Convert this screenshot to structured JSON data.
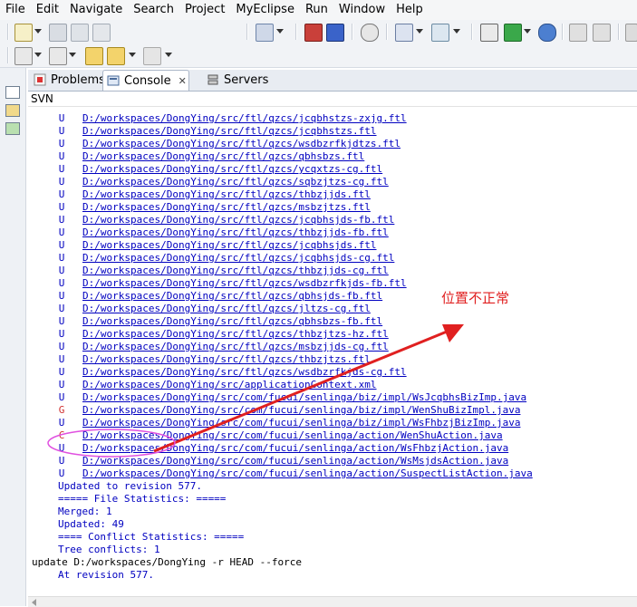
{
  "menu": [
    "File",
    "Edit",
    "Navigate",
    "Search",
    "Project",
    "MyEclipse",
    "Run",
    "Window",
    "Help"
  ],
  "tabs": [
    {
      "label": "Problems"
    },
    {
      "label": "Console"
    },
    {
      "label": "Servers"
    }
  ],
  "view_title": "SVN",
  "console_lines": [
    {
      "flag": "U",
      "text": "D:/workspaces/DongYing/src/ftl/qzcs/jcqbhstzs-zxjg.ftl",
      "flag_color": "#0000c0"
    },
    {
      "flag": "U",
      "text": "D:/workspaces/DongYing/src/ftl/qzcs/jcqbhstzs.ftl",
      "flag_color": "#0000c0"
    },
    {
      "flag": "U",
      "text": "D:/workspaces/DongYing/src/ftl/qzcs/wsdbzrfkjdtzs.ftl",
      "flag_color": "#0000c0"
    },
    {
      "flag": "U",
      "text": "D:/workspaces/DongYing/src/ftl/qzcs/qbhsbzs.ftl",
      "flag_color": "#0000c0"
    },
    {
      "flag": "U",
      "text": "D:/workspaces/DongYing/src/ftl/qzcs/ycqxtzs-cg.ftl",
      "flag_color": "#0000c0"
    },
    {
      "flag": "U",
      "text": "D:/workspaces/DongYing/src/ftl/qzcs/sqbzjtzs-cg.ftl",
      "flag_color": "#0000c0"
    },
    {
      "flag": "U",
      "text": "D:/workspaces/DongYing/src/ftl/qzcs/thbzjjds.ftl",
      "flag_color": "#0000c0"
    },
    {
      "flag": "U",
      "text": "D:/workspaces/DongYing/src/ftl/qzcs/msbzjtzs.ftl",
      "flag_color": "#0000c0"
    },
    {
      "flag": "U",
      "text": "D:/workspaces/DongYing/src/ftl/qzcs/jcqbhsjds-fb.ftl",
      "flag_color": "#0000c0"
    },
    {
      "flag": "U",
      "text": "D:/workspaces/DongYing/src/ftl/qzcs/thbzjjds-fb.ftl",
      "flag_color": "#0000c0"
    },
    {
      "flag": "U",
      "text": "D:/workspaces/DongYing/src/ftl/qzcs/jcqbhsjds.ftl",
      "flag_color": "#0000c0"
    },
    {
      "flag": "U",
      "text": "D:/workspaces/DongYing/src/ftl/qzcs/jcqbhsjds-cg.ftl",
      "flag_color": "#0000c0"
    },
    {
      "flag": "U",
      "text": "D:/workspaces/DongYing/src/ftl/qzcs/thbzjjds-cg.ftl",
      "flag_color": "#0000c0"
    },
    {
      "flag": "U",
      "text": "D:/workspaces/DongYing/src/ftl/qzcs/wsdbzrfkjds-fb.ftl",
      "flag_color": "#0000c0"
    },
    {
      "flag": "U",
      "text": "D:/workspaces/DongYing/src/ftl/qzcs/qbhsjds-fb.ftl",
      "flag_color": "#0000c0"
    },
    {
      "flag": "U",
      "text": "D:/workspaces/DongYing/src/ftl/qzcs/jltzs-cg.ftl",
      "flag_color": "#0000c0"
    },
    {
      "flag": "U",
      "text": "D:/workspaces/DongYing/src/ftl/qzcs/qbhsbzs-fb.ftl",
      "flag_color": "#0000c0"
    },
    {
      "flag": "U",
      "text": "D:/workspaces/DongYing/src/ftl/qzcs/thbzjtzs-hz.ftl",
      "flag_color": "#0000c0"
    },
    {
      "flag": "U",
      "text": "D:/workspaces/DongYing/src/ftl/qzcs/msbzjjds-cg.ftl",
      "flag_color": "#0000c0"
    },
    {
      "flag": "U",
      "text": "D:/workspaces/DongYing/src/ftl/qzcs/thbzjtzs.ftl",
      "flag_color": "#0000c0"
    },
    {
      "flag": "U",
      "text": "D:/workspaces/DongYing/src/ftl/qzcs/wsdbzrfkjds-cg.ftl",
      "flag_color": "#0000c0"
    },
    {
      "flag": "U",
      "text": "D:/workspaces/DongYing/src/applicationContext.xml",
      "flag_color": "#0000c0"
    },
    {
      "flag": "U",
      "text": "D:/workspaces/DongYing/src/com/fucui/senlinga/biz/impl/WsJcqbhsBizImp.java",
      "flag_color": "#0000c0"
    },
    {
      "flag": "G",
      "text": "D:/workspaces/DongYing/src/com/fucui/senlinga/biz/impl/WenShuBizImpl.java",
      "flag_color": "#d03030"
    },
    {
      "flag": "U",
      "text": "D:/workspaces/DongYing/src/com/fucui/senlinga/biz/impl/WsFhbzjBizImp.java",
      "flag_color": "#0000c0"
    },
    {
      "flag": "C",
      "text": "D:/workspaces/DongYing/src/com/fucui/senlinga/action/WenShuAction.java",
      "flag_color": "#d03030"
    },
    {
      "flag": "U",
      "text": "D:/workspaces/DongYing/src/com/fucui/senlinga/action/WsFhbzjAction.java",
      "flag_color": "#0000c0"
    },
    {
      "flag": "U",
      "text": "D:/workspaces/DongYing/src/com/fucui/senlinga/action/WsMsjdsAction.java",
      "flag_color": "#0000c0"
    },
    {
      "flag": "U",
      "text": "D:/workspaces/DongYing/src/com/fucui/senlinga/action/SuspectListAction.java",
      "flag_color": "#0000c0"
    }
  ],
  "summary_lines": [
    "Updated to revision 577.",
    "===== File Statistics: =====",
    "Merged: 1",
    "Updated: 49",
    "==== Conflict Statistics: =====",
    "Tree conflicts: 1"
  ],
  "command_line": "update D:/workspaces/DongYing -r HEAD --force",
  "revision_line": "At revision 577.",
  "annotation": {
    "text": "位置不正常",
    "color": "#e02020"
  }
}
